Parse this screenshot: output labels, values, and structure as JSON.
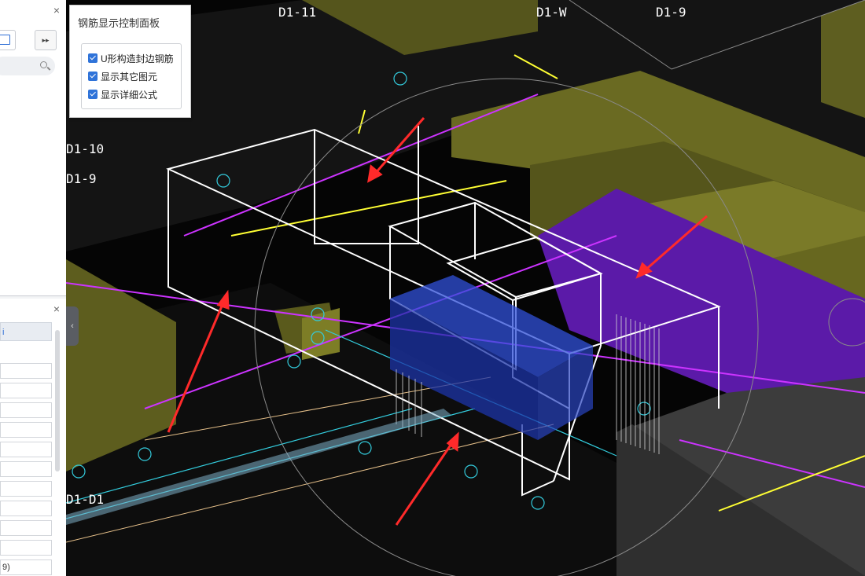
{
  "control_panel": {
    "title": "钢筋显示控制面板",
    "options": [
      {
        "label": "U形构造封边钢筋",
        "checked": true
      },
      {
        "label": "显示其它图元",
        "checked": true
      },
      {
        "label": "显示详细公式",
        "checked": true
      }
    ]
  },
  "left_panels": {
    "top_close": "×",
    "expand": "▸▸",
    "bottom_close": "×",
    "prop_header": "i",
    "collapse": "‹",
    "last_row_text": "9)"
  },
  "axis_labels": {
    "d1_11": "D1-11",
    "d1_w": "D1-W",
    "d1_9_top": "D1-9",
    "d1_10": "D1-10",
    "d1_9_left": "D1-9",
    "d1_d1": "D1-D1"
  },
  "colors": {
    "accent": "#2f73d9",
    "viewport_bg": "#050505",
    "olive_block": "#6f6f1f",
    "purple_grid": "#cc33ff",
    "yellow_grid": "#ffff33",
    "cyan_axis": "#33ccdd",
    "annotation_arrow": "#ff2a2a"
  }
}
